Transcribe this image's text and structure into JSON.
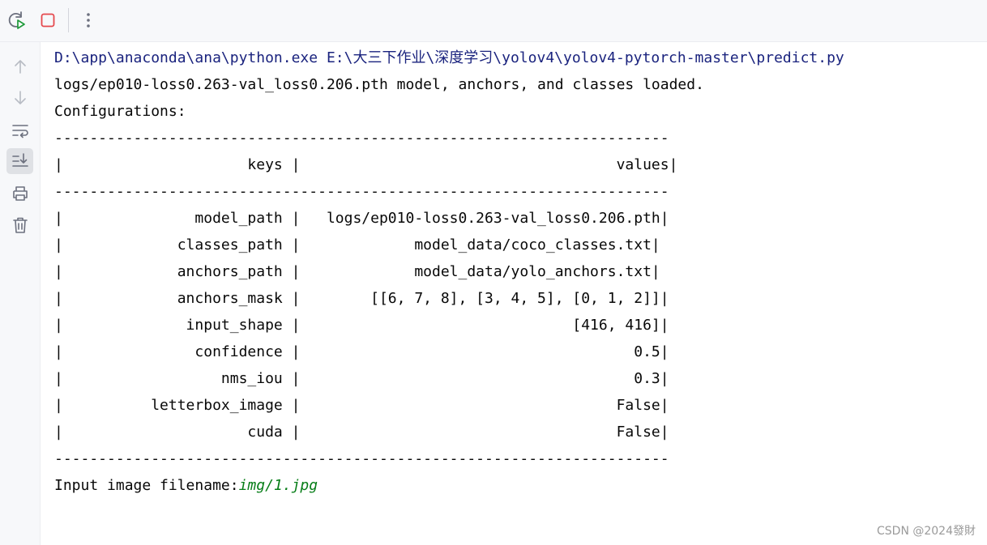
{
  "toolbar": {
    "rerun_icon": "rerun-icon",
    "stop_icon": "stop-icon",
    "more_icon": "more-vertical-icon",
    "stop_color": "#e5484d",
    "rerun_color": "#1e9a3a"
  },
  "sidebar": {
    "items": [
      {
        "name": "up-arrow-icon"
      },
      {
        "name": "down-arrow-icon"
      },
      {
        "name": "soft-wrap-icon"
      },
      {
        "name": "scroll-to-end-icon",
        "active": true
      },
      {
        "name": "print-icon"
      },
      {
        "name": "trash-icon"
      }
    ]
  },
  "console": {
    "command": "D:\\app\\anaconda\\ana\\python.exe E:\\大三下作业\\深度学习\\yolov4\\yolov4-pytorch-master\\predict.py",
    "loaded": "logs/ep010-loss0.263-val_loss0.206.pth model, anchors, and classes loaded.",
    "configurations": "Configurations:",
    "separator": "----------------------------------------------------------------------",
    "header_row": "|                     keys |                                    values|",
    "rows": [
      "|               model_path |   logs/ep010-loss0.263-val_loss0.206.pth|",
      "|             classes_path |             model_data/coco_classes.txt|",
      "|             anchors_path |             model_data/yolo_anchors.txt|",
      "|             anchors_mask |        [[6, 7, 8], [3, 4, 5], [0, 1, 2]]|",
      "|              input_shape |                               [416, 416]|",
      "|               confidence |                                      0.5|",
      "|                  nms_iou |                                      0.3|",
      "|          letterbox_image |                                    False|",
      "|                     cuda |                                    False|"
    ],
    "input_prompt": "Input image filename:",
    "input_value": "img/1.jpg"
  },
  "watermark": "CSDN @2024發財"
}
